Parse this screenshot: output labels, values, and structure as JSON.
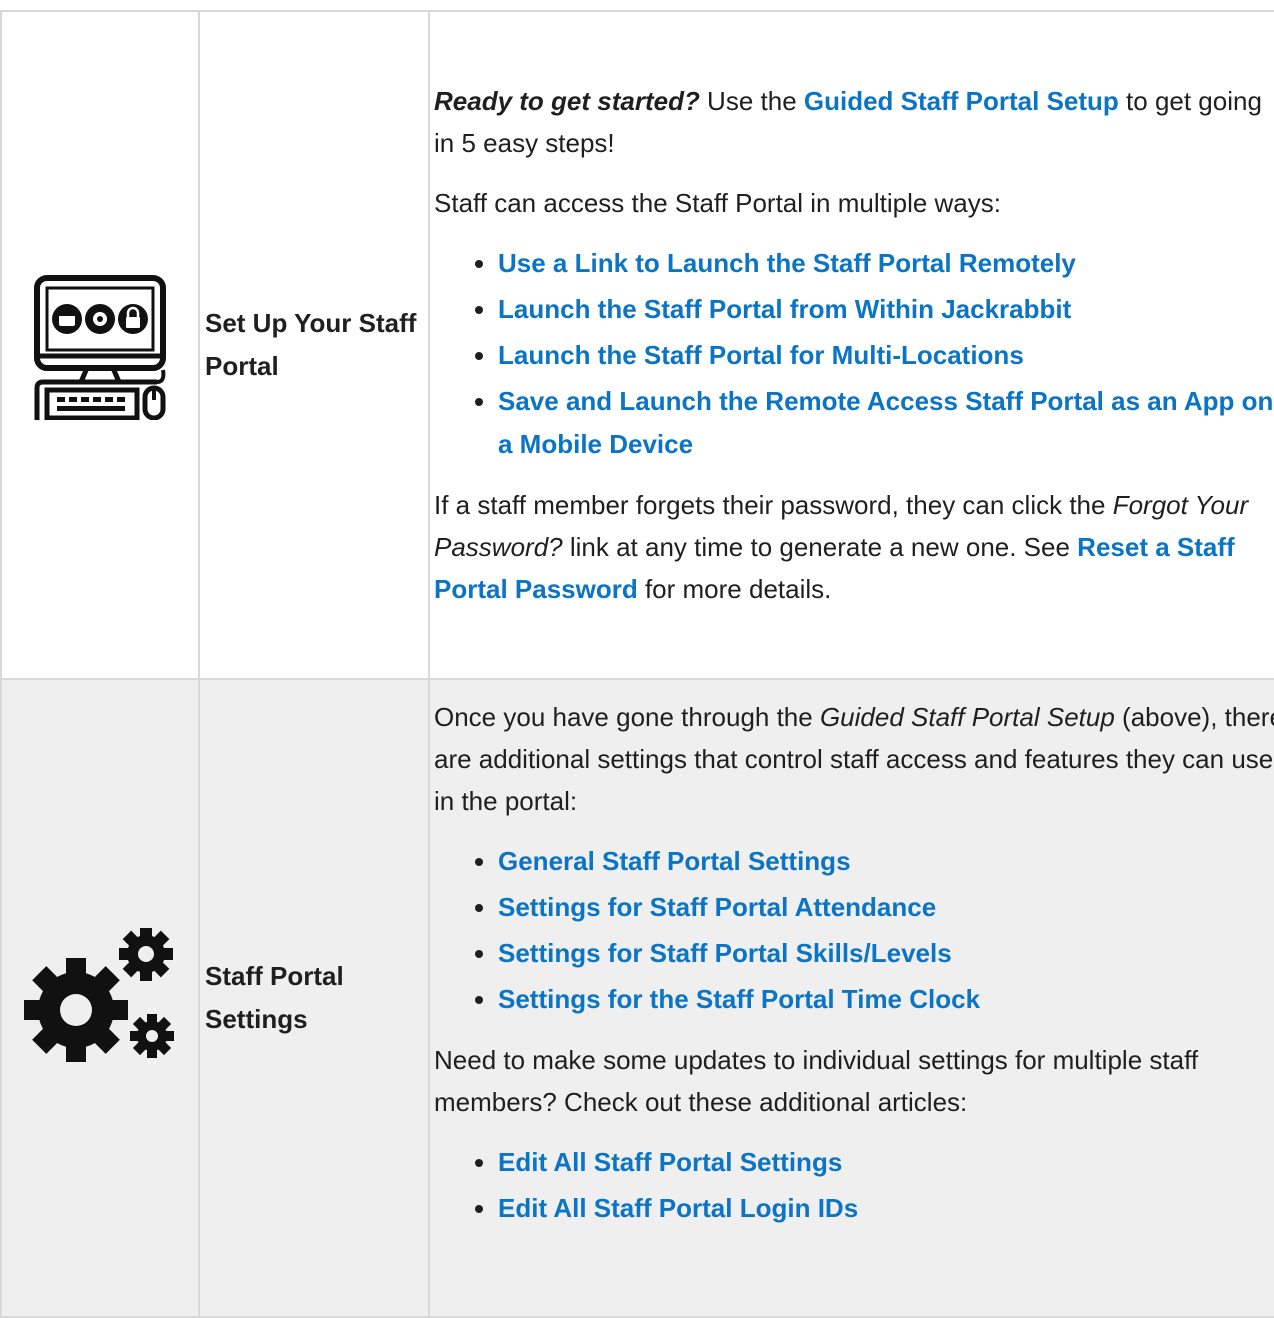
{
  "section1": {
    "title": "Set Up Your Staff Portal",
    "intro_bold_italic": "Ready to get started?",
    "intro_use": " Use the ",
    "intro_link": "Guided Staff Portal Setup",
    "intro_rest": " to get going in 5 easy steps!",
    "access_text": "Staff can access the Staff Portal in multiple ways:",
    "links": [
      "Use a Link to Launch the Staff Portal Remotely",
      "Launch the Staff Portal from Within Jackrabbit",
      "Launch the Staff Portal for Multi-Locations",
      "Save and Launch the Remote Access Staff Portal as an App on a Mobile Device"
    ],
    "password_pre": "If a staff member forgets their password, they can click the ",
    "password_italic": "Forgot Your Password?",
    "password_mid": "  link at any time to generate a new one. See ",
    "password_link": "Reset a Staff Portal Password",
    "password_post": " for more details."
  },
  "section2": {
    "title": "Staff Portal Settings",
    "intro_pre": "Once you have gone through the ",
    "intro_italic": "Guided Staff Portal Setup",
    "intro_post": " (above), there are additional settings that control staff access and features they can use in the portal:",
    "links": [
      "General Staff Portal Settings",
      "Settings for Staff Portal Attendance",
      "Settings for Staff Portal Skills/Levels",
      "Settings for the Staff Portal Time Clock"
    ],
    "multi_text": "Need to make some updates to individual settings for multiple staff members? Check out these additional articles:",
    "more_links": [
      "Edit All Staff Portal Settings",
      "Edit All Staff Portal Login IDs"
    ]
  },
  "icons": {
    "section1_icon": "computer-monitor-icon",
    "section2_icon": "gears-icon"
  },
  "colors": {
    "link": "#0b74c4",
    "border": "#d9d9d9",
    "row2_bg": "#efefef"
  }
}
